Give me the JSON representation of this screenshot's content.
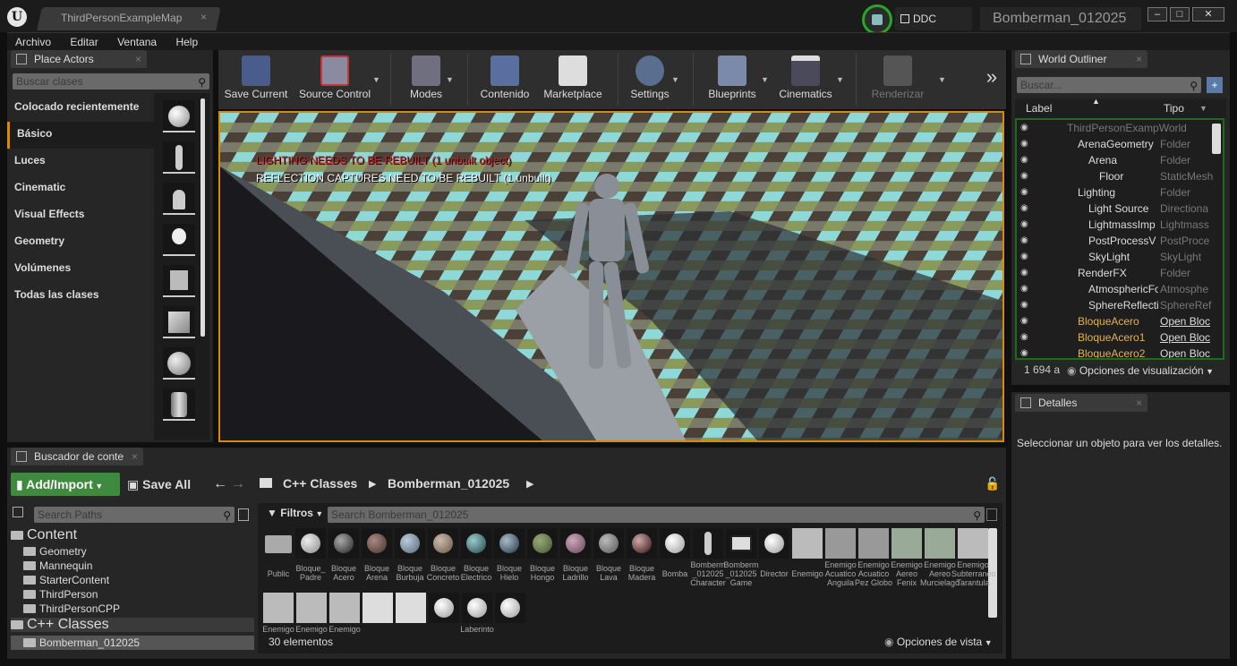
{
  "title_bar": {
    "logo": "ue-logo",
    "map_tab": "ThirdPersonExampleMap",
    "ddc_label": "DDC",
    "project_name": "Bomberman_012025"
  },
  "menu": [
    "Archivo",
    "Editar",
    "Ventana",
    "Help"
  ],
  "place_actors": {
    "tab_label": "Place Actors",
    "search_placeholder": "Buscar clases",
    "categories": [
      "Colocado recientemente",
      "Básico",
      "Luces",
      "Cinematic",
      "Visual Effects",
      "Geometry",
      "Volúmenes",
      "Todas las clases"
    ],
    "active_category": "Básico"
  },
  "toolbar": {
    "save_current": "Save Current",
    "source_control": "Source Control",
    "modes": "Modes",
    "contenido": "Contenido",
    "marketplace": "Marketplace",
    "settings": "Settings",
    "blueprints": "Blueprints",
    "cinematics": "Cinematics",
    "renderizar": "Renderizar",
    "more": "»"
  },
  "viewport": {
    "warning_lighting": "LIGHTING NEEDS TO BE REBUILT (1 unbuilt object)",
    "warning_reflection": "REFLECTION CAPTURES NEED TO BE REBUILT (1 unbuilt)"
  },
  "world_outliner": {
    "tab_label": "World Outliner",
    "search_placeholder": "Buscar...",
    "col_label": "Label",
    "col_type": "Tipo",
    "rows": [
      {
        "label": "ThirdPersonExampWorld",
        "type": ""
      },
      {
        "label": "ArenaGeometry",
        "type": "Folder"
      },
      {
        "label": "Arena",
        "type": "Folder"
      },
      {
        "label": "Floor",
        "type": "StaticMesh"
      },
      {
        "label": "Lighting",
        "type": "Folder"
      },
      {
        "label": "Light Source",
        "type": "Directiona"
      },
      {
        "label": "LightmassImp",
        "type": "Lightmass"
      },
      {
        "label": "PostProcessV",
        "type": "PostProce"
      },
      {
        "label": "SkyLight",
        "type": "SkyLight"
      },
      {
        "label": "RenderFX",
        "type": "Folder"
      },
      {
        "label": "AtmosphericFo",
        "type": "Atmosphe"
      },
      {
        "label": "SphereReflecti",
        "type": "SphereRef"
      },
      {
        "label": "BloqueAcero",
        "type": "Open Bloc"
      },
      {
        "label": "BloqueAcero1",
        "type": "Open Bloc"
      },
      {
        "label": "BloqueAcero2",
        "type": "Open Bloc"
      }
    ],
    "count": "1 694 a",
    "view_options": "Opciones de visualización"
  },
  "details": {
    "tab_label": "Detalles",
    "empty_message": "Seleccionar un objeto para ver los detalles."
  },
  "content_browser": {
    "tab_label": "Buscador de conte",
    "add_import": "Add/Import",
    "save_all": "Save All",
    "path": [
      "C++ Classes",
      "Bomberman_012025"
    ],
    "search_paths_placeholder": "Search Paths",
    "filters": "Filtros",
    "search_placeholder": "Search Bomberman_012025",
    "tree": [
      "Content",
      "Geometry",
      "Mannequin",
      "StarterContent",
      "ThirdPerson",
      "ThirdPersonCPP",
      "C++ Classes",
      "Bomberman_012025"
    ],
    "assets": [
      "Public",
      "Bloque_ Padre",
      "Bloque Acero",
      "Bloque Arena",
      "Bloque Burbuja",
      "Bloque Concreto",
      "Bloque Electrico",
      "Bloque Hielo",
      "Bloque Hongo",
      "Bloque Ladrillo",
      "Bloque Lava",
      "Bloque Madera",
      "Bomba",
      "Bomberm _012025 Character",
      "Bomberm _012025 Game Mode",
      "Director",
      "Enemigo",
      "Enemigo Acuatico Anguila",
      "Enemigo Acuatico Pez Globo",
      "Enemigo Aereo Fenix",
      "Enemigo Aereo Murcielago",
      "Enemigo Subterraneo Tarantula"
    ],
    "assets_row2": [
      "Enemigo",
      "Enemigo",
      "Enemigo",
      "",
      "",
      "",
      "Laberinto",
      ""
    ],
    "count": "30 elementos",
    "view_options": "Opciones de vista"
  }
}
